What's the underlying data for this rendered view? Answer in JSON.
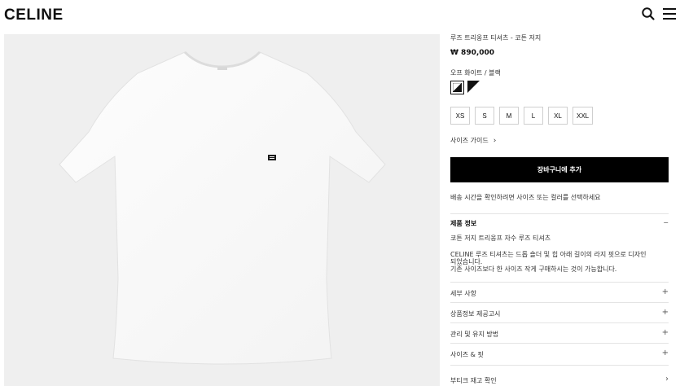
{
  "header": {
    "logo": "CELINE",
    "search_icon": "search-icon",
    "menu_icon": "hamburger-menu-icon"
  },
  "product": {
    "title": "루즈 트리옹프 티셔츠 - 코튼 저지",
    "price": "₩ 890,000",
    "color_name": "오프 화이트 / 블랙",
    "swatches": [
      {
        "name": "off-white-black",
        "selected": true,
        "colors": [
          "#ffffff",
          "#111111"
        ]
      },
      {
        "name": "black-white",
        "selected": false,
        "colors": [
          "#111111",
          "#ffffff"
        ]
      }
    ],
    "sizes": [
      "XS",
      "S",
      "M",
      "L",
      "XL",
      "XXL"
    ],
    "size_guide": "사이즈 가이드",
    "add_to_cart": "장바구니에 추가",
    "notice": "배송 시간을 확인하려면 사이즈 또는 컬러를 선택하세요"
  },
  "product_info": {
    "heading": "제품 정보",
    "toggle": "−",
    "subtitle": "코튼 저지 트리옹프 자수 루즈 티셔츠",
    "body_line1": "CELINE 루즈 티셔츠는 드롭 숄더 및 힙 아래 길이의 라지 핏으로 디자인",
    "body_line2": "되었습니다.",
    "body_line3": "기존 사이즈보다 한 사이즈 작게 구매하시는 것이 가능합니다."
  },
  "accordion": [
    {
      "label": "세부 사항",
      "sign": "+"
    },
    {
      "label": "상품정보 제공고시",
      "sign": "+"
    },
    {
      "label": "관리 및 유지 방법",
      "sign": "+"
    },
    {
      "label": "사이즈 & 핏",
      "sign": "+"
    },
    {
      "label": "부티크 재고 확인",
      "sign": "›"
    }
  ],
  "chevron": "›",
  "colors": {
    "gallery_bg": "#efefef",
    "button_bg": "#000000",
    "text": "#111111"
  }
}
